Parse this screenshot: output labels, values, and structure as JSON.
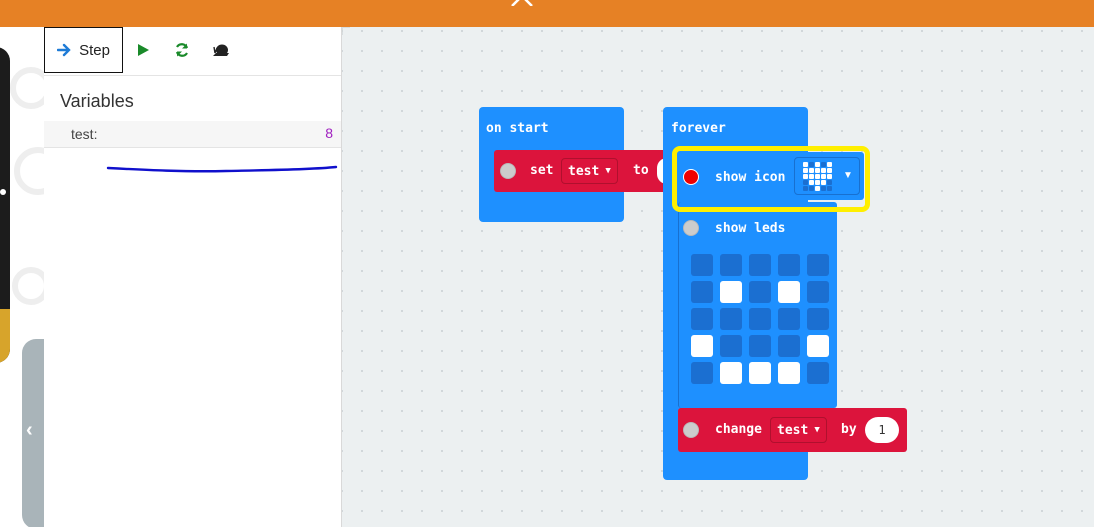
{
  "colors": {
    "topbar": "#e68125",
    "block_basic": "#1e90ff",
    "block_variables": "#dc143c",
    "highlight": "#ffef00",
    "step_icon": "#1e7bd6",
    "play_icon": "#1a8a2a",
    "restart_icon": "#1a8a2a",
    "variable_value": "#a020c0"
  },
  "toolbar": {
    "step_label": "Step",
    "icons": [
      "arrow-right-icon",
      "play-icon",
      "restart-icon",
      "snail-icon"
    ]
  },
  "variables": {
    "title": "Variables",
    "items": [
      {
        "name": "test:",
        "value": "8"
      }
    ]
  },
  "blocks": {
    "on_start": {
      "label": "on start",
      "set": {
        "keyword": "set",
        "variable": "test",
        "connector": "to"
      }
    },
    "forever": {
      "label": "forever",
      "show_icon": {
        "label": "show icon",
        "icon": "heart-icon",
        "highlighted": true
      },
      "show_leds": {
        "label": "show leds",
        "grid": [
          [
            0,
            0,
            0,
            0,
            0
          ],
          [
            0,
            1,
            0,
            1,
            0
          ],
          [
            0,
            0,
            0,
            0,
            0
          ],
          [
            1,
            0,
            0,
            0,
            1
          ],
          [
            0,
            1,
            1,
            1,
            0
          ]
        ]
      },
      "change": {
        "keyword": "change",
        "variable": "test",
        "connector": "by",
        "amount": "1"
      }
    }
  }
}
